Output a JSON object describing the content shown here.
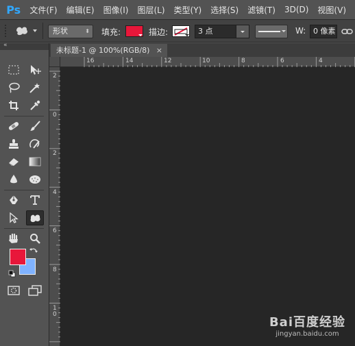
{
  "app": {
    "logo": "Ps",
    "accent": "#31a8ff"
  },
  "menu": [
    {
      "label": "文件(F)"
    },
    {
      "label": "编辑(E)"
    },
    {
      "label": "图像(I)"
    },
    {
      "label": "图层(L)"
    },
    {
      "label": "类型(Y)"
    },
    {
      "label": "选择(S)"
    },
    {
      "label": "滤镜(T)"
    },
    {
      "label": "3D(D)"
    },
    {
      "label": "视图(V)"
    }
  ],
  "options": {
    "tool_icon": "custom-shape-icon",
    "mode": "形状",
    "fill_label": "填充:",
    "fill_color": "#e8173a",
    "stroke_label": "描边:",
    "stroke_swatch": "no-stroke-icon",
    "stroke_width": "3 点",
    "stroke_style": "solid-line",
    "w_label": "W:",
    "w_value": "0 像素",
    "link_icon": "link-icon"
  },
  "document": {
    "tab_title": "未标题-1 @ 100%(RGB/8)",
    "close_glyph": "×"
  },
  "ruler_top": [
    "16",
    "14",
    "12",
    "10",
    "8",
    "6",
    "4"
  ],
  "ruler_left": [
    "2",
    "0",
    "2",
    "4",
    "6",
    "8",
    "10"
  ],
  "colors": {
    "foreground": "#e8173a",
    "background": "#7fb2ff"
  },
  "watermark": {
    "main": "Bai百度经验",
    "url": "jingyan.baidu.com"
  }
}
